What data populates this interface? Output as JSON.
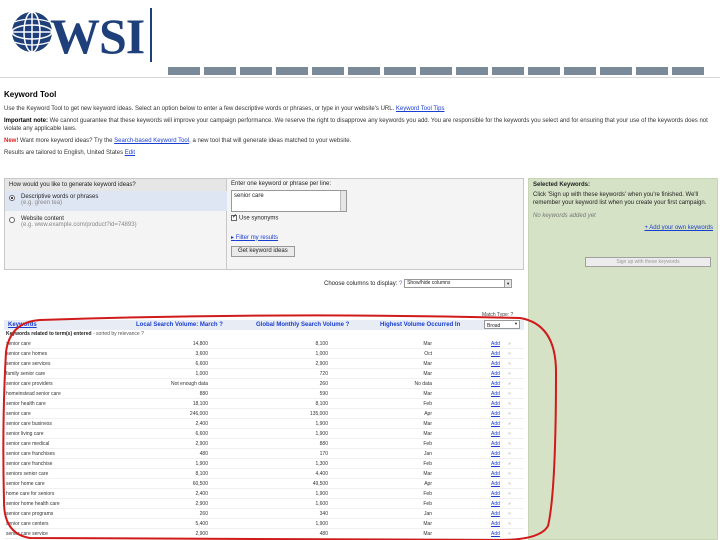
{
  "brand": {
    "logo_text": "WSI"
  },
  "tool": {
    "title": "Keyword Tool",
    "intro": "Use the Keyword Tool to get new keyword ideas. Select an option below to enter a few descriptive words or phrases, or type in your website's URL.",
    "intro_link": "Keyword Tool Tips",
    "important_label": "Important note:",
    "important_text": "We cannot guarantee that these keywords will improve your campaign performance. We reserve the right to disapprove any keywords you add. You are responsible for the keywords you select and for ensuring that your use of the keywords does not violate any applicable laws.",
    "new_label": "New!",
    "want_more": "Want more keyword ideas? Try the",
    "want_more_link": "Search-based Keyword Tool",
    "want_more_tail": ", a new tool that will generate ideas matched to your website.",
    "results_note": "Results are tailored to English, United States",
    "results_edit": "Edit"
  },
  "form": {
    "question": "How would you like to generate keyword ideas?",
    "opt1_label": "Descriptive words or phrases",
    "opt1_sub": "(e.g. green tea)",
    "opt2_label": "Website content",
    "opt2_sub": "(e.g. www.example.com/product?id=74893)",
    "enter_label": "Enter one keyword or phrase per line:",
    "keyword_value": "senior care",
    "synonyms_label": "Use synonyms",
    "filter_label": "Filter my results",
    "get_button": "Get keyword ideas"
  },
  "selected": {
    "title": "Selected Keywords:",
    "help": "Click 'Sign up with these keywords' when you're finished. We'll remember your keyword list when you create your first campaign.",
    "empty": "No keywords added yet",
    "add_own": "+ Add your own keywords",
    "signup_button": "Sign up with these keywords"
  },
  "columns": {
    "label": "Choose columns to display:",
    "help_icon": "?",
    "select_value": "Show/hide columns"
  },
  "table": {
    "match_type": "Match Type: ?",
    "match_select": "Broad",
    "headers": {
      "keywords": "Keywords",
      "lsv": "Local Search Volume: March ?",
      "gmsv": "Global Monthly Search Volume ?",
      "hv": "Highest Volume Occurred In"
    },
    "subheader": "Keywords related to term(s) entered",
    "subheader_sort": "- sorted by relevance ?",
    "rows": [
      [
        "senior care",
        "14,800",
        "8,100",
        "Mar"
      ],
      [
        "senior care homes",
        "3,600",
        "1,000",
        "Oct"
      ],
      [
        "senior care services",
        "6,600",
        "2,900",
        "Mar"
      ],
      [
        "family senior care",
        "1,000",
        "720",
        "Mar"
      ],
      [
        "senior care providers",
        "Not enough data",
        "260",
        "No data"
      ],
      [
        "homeinstead senior care",
        "880",
        "590",
        "Mar"
      ],
      [
        "senior health care",
        "18,100",
        "8,100",
        "Feb"
      ],
      [
        "senior care",
        "246,000",
        "135,000",
        "Apr"
      ],
      [
        "senior care business",
        "2,400",
        "1,900",
        "Mar"
      ],
      [
        "senior living care",
        "6,600",
        "1,900",
        "Mar"
      ],
      [
        "senior care medical",
        "2,900",
        "880",
        "Feb"
      ],
      [
        "senior care franchises",
        "480",
        "170",
        "Jan"
      ],
      [
        "senior care franchise",
        "1,900",
        "1,300",
        "Feb"
      ],
      [
        "seniors senior care",
        "8,100",
        "4,400",
        "Mar"
      ],
      [
        "senior home care",
        "60,500",
        "49,500",
        "Apr"
      ],
      [
        "home care for seniors",
        "2,400",
        "1,900",
        "Feb"
      ],
      [
        "senior home health care",
        "2,900",
        "1,600",
        "Feb"
      ],
      [
        "senior care programs",
        "260",
        "340",
        "Jan"
      ],
      [
        "senior care centers",
        "5,400",
        "1,900",
        "Mar"
      ],
      [
        "senior care service",
        "2,900",
        "480",
        "Mar"
      ]
    ],
    "add_label": "Add",
    "add_icon": "»"
  },
  "colors": {
    "brand_blue": "#1e3f7a",
    "link_blue": "#1a3ecf",
    "panel_green": "#d6e2c6",
    "annotation_red": "#d11a1a"
  }
}
